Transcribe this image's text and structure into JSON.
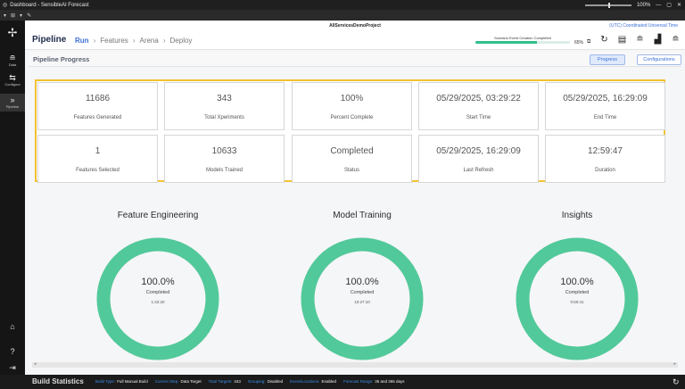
{
  "window": {
    "title": "Dashboard - SensibleAI Forecast",
    "zoom": "100%"
  },
  "sidebar": {
    "items": [
      {
        "label": "",
        "icon": "logo-icon"
      },
      {
        "label": "Data",
        "icon": "database-icon"
      },
      {
        "label": "Configure",
        "icon": "sliders-icon"
      },
      {
        "label": "Pipeline",
        "icon": "chevrons-icon"
      }
    ],
    "bottom": [
      {
        "icon": "home-icon"
      },
      {
        "icon": "help-icon"
      },
      {
        "icon": "logout-icon"
      }
    ]
  },
  "header": {
    "project": "AllServicesDemoProject",
    "timezone": "(UTC) Coordinated Universal Time",
    "page_title": "Pipeline",
    "crumbs": [
      "Run",
      "Features",
      "Arena",
      "Deploy"
    ],
    "progress": {
      "label": "Scenario Event Creation Completed",
      "percent": "65%",
      "fraction": 0.65
    }
  },
  "subheader": {
    "title": "Pipeline Progress",
    "progress_button": "Progress",
    "configurations_button": "Configurations"
  },
  "stats": [
    {
      "value": "11686",
      "label": "Features Generated"
    },
    {
      "value": "343",
      "label": "Total Xperiments"
    },
    {
      "value": "100%",
      "label": "Percent Complete"
    },
    {
      "value": "05/29/2025, 03:29:22",
      "label": "Start Time"
    },
    {
      "value": "05/29/2025, 16:29:09",
      "label": "End Time"
    },
    {
      "value": "1",
      "label": "Features Selected"
    },
    {
      "value": "10633",
      "label": "Models Trained"
    },
    {
      "value": "Completed",
      "label": "Status"
    },
    {
      "value": "05/29/2025, 16:29:09",
      "label": "Last Refresh"
    },
    {
      "value": "12:59:47",
      "label": "Duration"
    }
  ],
  "rings": [
    {
      "title": "Feature Engineering",
      "percent": "100.0%",
      "status": "Completed",
      "duration": "1:42:20",
      "fraction": 1.0
    },
    {
      "title": "Model Training",
      "percent": "100.0%",
      "status": "Completed",
      "duration": "10:27:10",
      "fraction": 1.0
    },
    {
      "title": "Insights",
      "percent": "100.0%",
      "status": "Completed",
      "duration": "0:50:41",
      "fraction": 1.0
    }
  ],
  "colors": {
    "ring": "#52c99a",
    "highlight": "#f2c230",
    "accent": "#3a6fd8"
  },
  "footer": {
    "title": "Build Statistics",
    "items": [
      {
        "key": "Build Type:",
        "value": "Full Manual Build"
      },
      {
        "key": "Current Step:",
        "value": "Data Target"
      },
      {
        "key": "Total Targets:",
        "value": "343"
      },
      {
        "key": "Grouping:",
        "value": "Disabled"
      },
      {
        "key": "Event/Locations:",
        "value": "Enabled"
      },
      {
        "key": "Forecast Range:",
        "value": "35 and 365 days"
      }
    ]
  }
}
